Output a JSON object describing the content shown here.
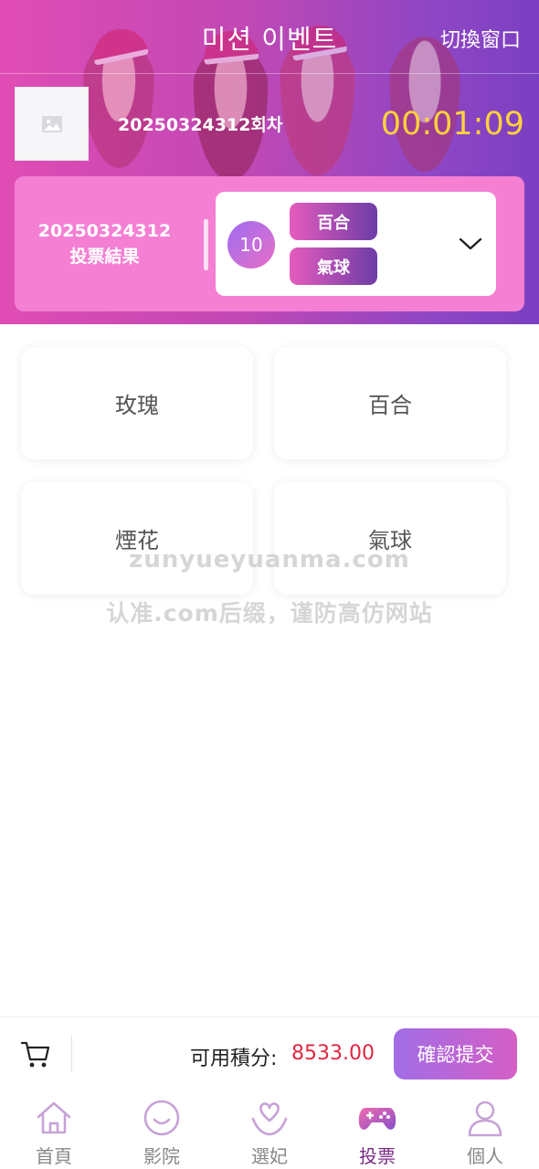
{
  "header": {
    "title": "미션 이벤트",
    "switch_label": "切換窗口",
    "round_label": "20250324312회차",
    "countdown": "00:01:09"
  },
  "result": {
    "period": "20250324312",
    "label": "投票結果",
    "number": "10",
    "tags": [
      "百合",
      "氣球"
    ]
  },
  "options": [
    "玫瑰",
    "百合",
    "煙花",
    "氣球"
  ],
  "watermark": {
    "line1": "zunyueyuanma.com",
    "line2": "认准.com后缀，谨防高仿网站"
  },
  "submit_bar": {
    "points_label": "可用積分:",
    "points_value": "8533.00",
    "confirm_label": "確認提交"
  },
  "tabs": [
    {
      "label": "首頁",
      "icon": "home-icon"
    },
    {
      "label": "影院",
      "icon": "smile-icon"
    },
    {
      "label": "選妃",
      "icon": "heart-person-icon"
    },
    {
      "label": "投票",
      "icon": "gamepad-icon",
      "active": true
    },
    {
      "label": "個人",
      "icon": "user-icon"
    }
  ],
  "colors": {
    "header_gradient_start": "#e04cb4",
    "header_gradient_end": "#7b3fc2",
    "timer": "#ffd23b",
    "points": "#e02842",
    "active_tab": "#7a2b84"
  }
}
